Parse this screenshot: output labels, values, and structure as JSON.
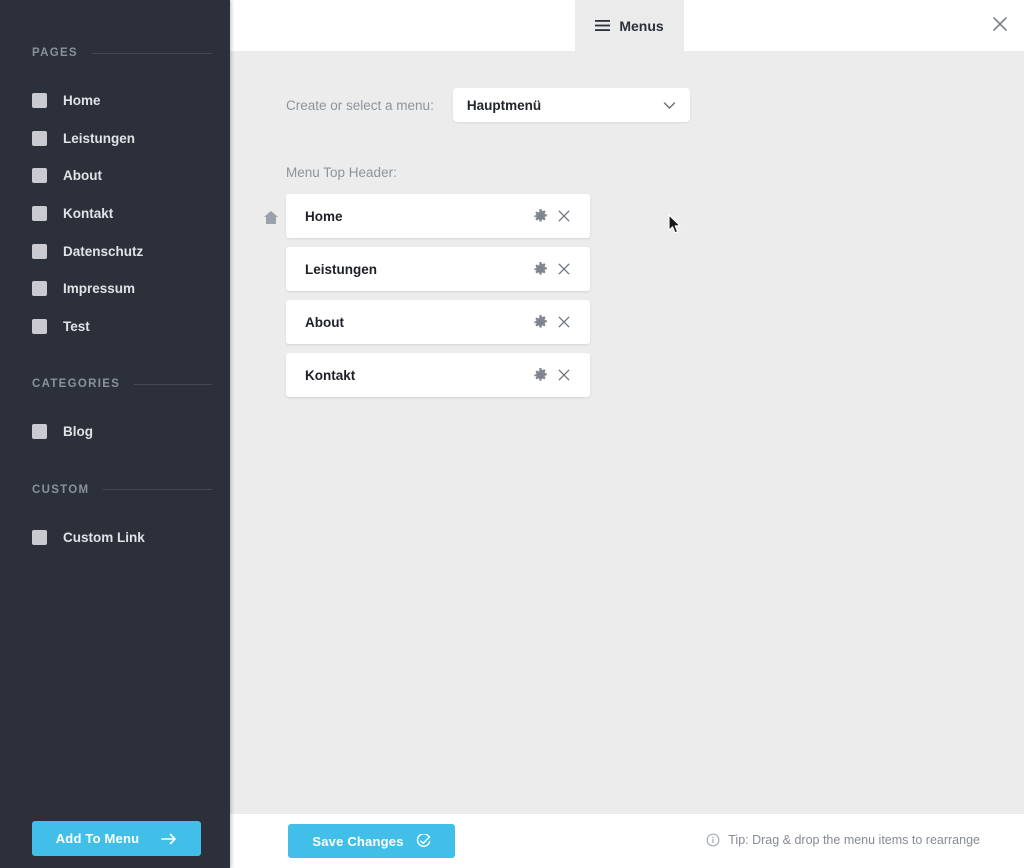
{
  "colors": {
    "sidebar_bg": "#2b303a",
    "accent": "#41bfe8",
    "content_bg": "#ececec",
    "tab_bg": "#ebebeb",
    "card_bg": "#ffffff",
    "muted_text": "#8e949c"
  },
  "sidebar": {
    "sections": [
      {
        "title": "PAGES",
        "items": [
          {
            "label": "Home"
          },
          {
            "label": "Leistungen"
          },
          {
            "label": "About"
          },
          {
            "label": "Kontakt"
          },
          {
            "label": "Datenschutz"
          },
          {
            "label": "Impressum"
          },
          {
            "label": "Test"
          }
        ]
      },
      {
        "title": "CATEGORIES",
        "items": [
          {
            "label": "Blog"
          }
        ]
      },
      {
        "title": "CUSTOM",
        "items": [
          {
            "label": "Custom Link"
          }
        ]
      }
    ],
    "add_to_menu_label": "Add To Menu",
    "add_to_menu_icon": "arrow-right-icon"
  },
  "topbar": {
    "tab_label": "Menus",
    "tab_icon": "hamburger-icon",
    "close_icon": "close-icon"
  },
  "main": {
    "select_label": "Create or select a menu:",
    "selected_menu": "Hauptmenü",
    "select_options": [
      "Hauptmenü"
    ],
    "chevron_icon": "chevron-down-icon",
    "menu_header_label": "Menu Top Header:",
    "menu_items": [
      {
        "label": "Home",
        "leading_icon": "home-icon",
        "settings_icon": "gear-icon",
        "remove_icon": "close-icon"
      },
      {
        "label": "Leistungen",
        "leading_icon": "",
        "settings_icon": "gear-icon",
        "remove_icon": "close-icon"
      },
      {
        "label": "About",
        "leading_icon": "",
        "settings_icon": "gear-icon",
        "remove_icon": "close-icon"
      },
      {
        "label": "Kontakt",
        "leading_icon": "",
        "settings_icon": "gear-icon",
        "remove_icon": "close-icon"
      }
    ]
  },
  "bottombar": {
    "save_label": "Save Changes",
    "save_icon": "check-circle-icon",
    "tip_icon": "info-icon",
    "tip_text": "Tip: Drag & drop the menu items to rearrange"
  }
}
